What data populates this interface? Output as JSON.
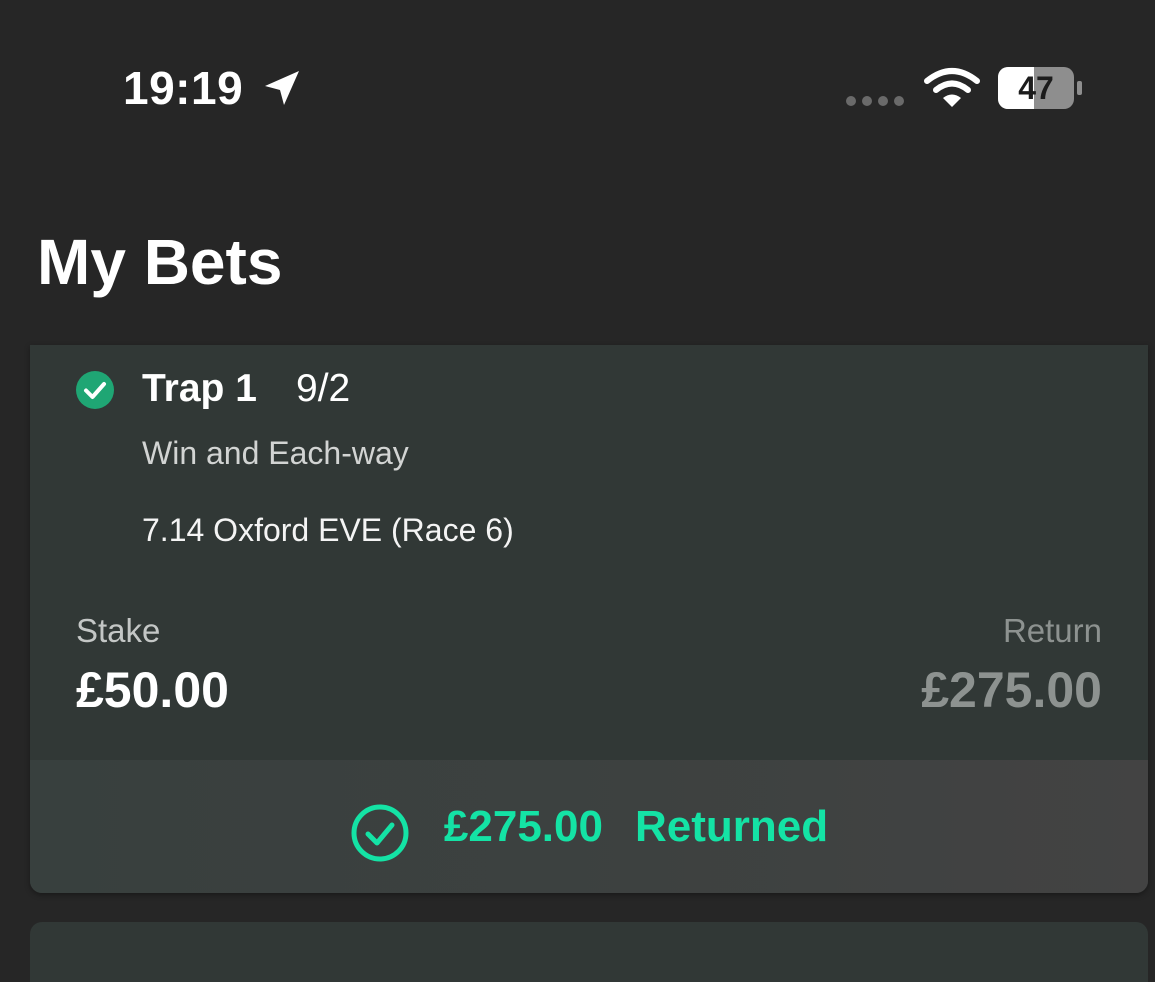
{
  "status_bar": {
    "time": "19:19",
    "battery": "47",
    "icons": [
      "location-arrow-icon",
      "cellular-signal-icon",
      "wifi-icon",
      "battery-icon"
    ]
  },
  "page": {
    "title": "My Bets"
  },
  "bet": {
    "selection": "Trap 1",
    "odds": "9/2",
    "bet_type": "Win and Each-way",
    "event": "7.14 Oxford EVE (Race 6)",
    "stake_label": "Stake",
    "stake": "£50.00",
    "return_label": "Return",
    "return": "£275.00",
    "status_icon": "check-circle-icon",
    "returned": {
      "amount": "£275.00",
      "label": "Returned",
      "icon": "check-circle-outline-icon"
    }
  },
  "colors": {
    "background": "#262626",
    "card": "#313836",
    "accent_green": "#14e3a5",
    "settled_green": "#1fa674",
    "muted_text": "#8d9290"
  }
}
